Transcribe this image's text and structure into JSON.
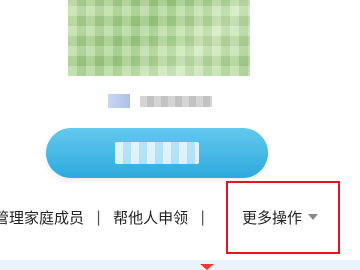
{
  "links": {
    "manage_family": "管理家庭成员",
    "separator": "|",
    "help_apply": "帮他人申领",
    "more_actions": "更多操作"
  },
  "icons": {
    "qr_code": "qr-code-icon",
    "dropdown": "caret-down-icon",
    "pointer": "triangle-pointer-icon"
  },
  "colors": {
    "accent_button": "#2ea9de",
    "highlight_border": "#e8141b",
    "qr_tint": "#a9d88e"
  }
}
